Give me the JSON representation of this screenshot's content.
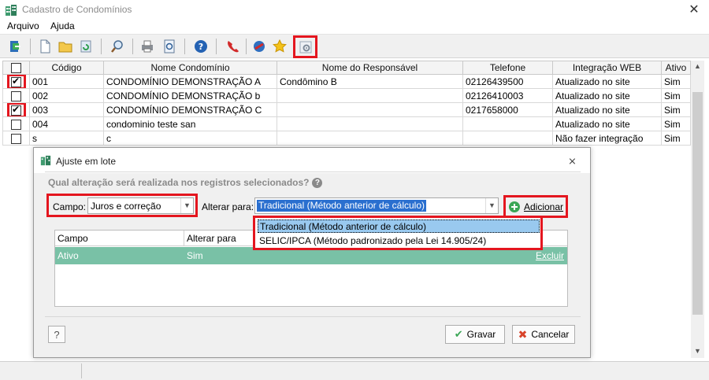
{
  "window": {
    "title": "Cadastro de Condomínios",
    "close_glyph": "✕"
  },
  "menu": {
    "items": [
      "Arquivo",
      "Ajuda"
    ]
  },
  "toolbar": {
    "buttons": [
      "exit-icon",
      "new-document-icon",
      "open-folder-icon",
      "refresh-icon",
      "search-icon",
      "print-icon",
      "print-preview-icon",
      "help-icon",
      "phone-icon",
      "web-icon",
      "star-icon",
      "batch-settings-icon"
    ]
  },
  "grid": {
    "columns": [
      "",
      "Código",
      "Nome Condomínio",
      "Nome do Responsável",
      "Telefone",
      "Integração WEB",
      "Ativo"
    ],
    "rows": [
      {
        "checked": true,
        "codigo": "001",
        "nome": "CONDOMÍNIO DEMONSTRAÇÃO A",
        "responsavel": "Condômino B",
        "telefone": "02126439500",
        "integracao": "Atualizado no site",
        "ativo": "Sim"
      },
      {
        "checked": false,
        "codigo": "002",
        "nome": "CONDOMÍNIO DEMONSTRAÇÃO b",
        "responsavel": "",
        "telefone": "02126410003",
        "integracao": "Atualizado no site",
        "ativo": "Sim"
      },
      {
        "checked": true,
        "codigo": "003",
        "nome": "CONDOMÍNIO DEMONSTRAÇÃO C",
        "responsavel": "",
        "telefone": "0217658000",
        "integracao": "Atualizado no site",
        "ativo": "Sim"
      },
      {
        "checked": false,
        "codigo": "004",
        "nome": "condominio teste san",
        "responsavel": "",
        "telefone": "",
        "integracao": "Atualizado no site",
        "ativo": "Sim"
      },
      {
        "checked": false,
        "codigo": "s",
        "nome": "c",
        "responsavel": "",
        "telefone": "",
        "integracao": "Não fazer integração",
        "ativo": "Sim"
      }
    ]
  },
  "dialog": {
    "title": "Ajuste em lote",
    "question": "Qual alteração será realizada nos registros selecionados?",
    "campo_label": "Campo:",
    "campo_value": "Juros e correção",
    "alterar_label": "Alterar para:",
    "alterar_value": "Tradicional (Método anterior de cálculo)",
    "add_button": "Adicionar",
    "options": [
      "Tradicional (Método anterior de cálculo)",
      "SELIC/IPCA (Método padronizado pela Lei 14.905/24)"
    ],
    "table": {
      "headers": [
        "Campo",
        "Alterar para"
      ],
      "rows": [
        {
          "campo": "Ativo",
          "alterar": "Sim",
          "action": "Excluir"
        }
      ]
    },
    "help_button": "?",
    "save_button": "Gravar",
    "cancel_button": "Cancelar"
  },
  "colors": {
    "highlight": "#e4161f",
    "selected_row": "#79c1a6",
    "dropdown_selected": "#99c9ef"
  }
}
